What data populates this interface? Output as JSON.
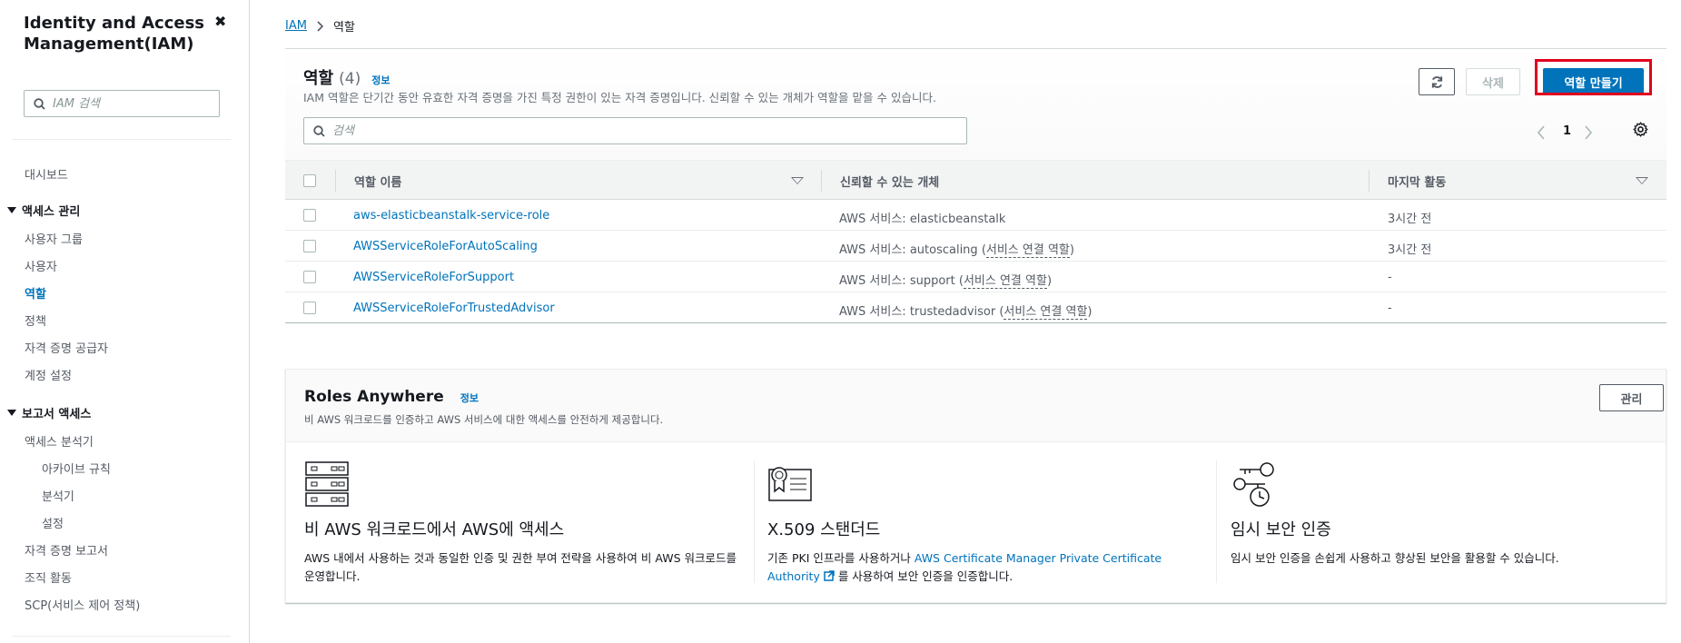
{
  "sidebar": {
    "title": "Identity and Access Management(IAM)",
    "search_placeholder": "IAM 검색",
    "dashboard": "대시보드",
    "access_mgmt": {
      "label": "액세스 관리",
      "items": [
        "사용자 그룹",
        "사용자",
        "역할",
        "정책",
        "자격 증명 공급자",
        "계정 설정"
      ]
    },
    "reports": {
      "label": "보고서 액세스",
      "items": [
        "액세스 분석기",
        "아카이브 규칙",
        "분석기",
        "설정",
        "자격 증명 보고서",
        "조직 활동",
        "SCP(서비스 제어 정책)"
      ]
    }
  },
  "breadcrumb": {
    "root": "IAM",
    "current": "역할"
  },
  "roles": {
    "title": "역할",
    "count": "(4)",
    "info": "정보",
    "description": "IAM 역할은 단기간 동안 유효한 자격 증명을 가진 특정 권한이 있는 자격 증명입니다. 신뢰할 수 있는 개체가 역할을 맡을 수 있습니다.",
    "delete_label": "삭제",
    "create_label": "역할 만들기",
    "search_placeholder": "검색",
    "page": "1",
    "columns": [
      "역할 이름",
      "신뢰할 수 있는 개체",
      "마지막 활동"
    ],
    "rows": [
      {
        "name": "aws-elasticbeanstalk-service-role",
        "trusted_prefix": "AWS 서비스: elasticbeanstalk",
        "trusted_open": "",
        "trusted_link": "",
        "trusted_close": "",
        "activity": "3시간 전"
      },
      {
        "name": "AWSServiceRoleForAutoScaling",
        "trusted_prefix": "AWS 서비스: autoscaling ",
        "trusted_open": "(",
        "trusted_link": "서비스 연결 역할",
        "trusted_close": ")",
        "activity": "3시간 전"
      },
      {
        "name": "AWSServiceRoleForSupport",
        "trusted_prefix": "AWS 서비스: support ",
        "trusted_open": "(",
        "trusted_link": "서비스 연결 역할",
        "trusted_close": ")",
        "activity": "-"
      },
      {
        "name": "AWSServiceRoleForTrustedAdvisor",
        "trusted_prefix": "AWS 서비스: trustedadvisor ",
        "trusted_open": "(",
        "trusted_link": "서비스 연결 역할",
        "trusted_close": ")",
        "activity": "-"
      }
    ]
  },
  "roles_anywhere": {
    "title": "Roles Anywhere",
    "info": "정보",
    "description": "비 AWS 워크로드를 인증하고 AWS 서비스에 대한 액세스를 안전하게 제공합니다.",
    "manage_label": "관리",
    "col1": {
      "title": "비 AWS 워크로드에서 AWS에 액세스",
      "desc": "AWS 내에서 사용하는 것과 동일한 인증 및 권한 부여 전략을 사용하여 비 AWS 워크로드를 운영합니다."
    },
    "col2": {
      "title": "X.509 스탠더드",
      "desc_pre": "기존 PKI 인프라를 사용하거나 ",
      "desc_link": "AWS Certificate Manager Private Certificate Authority",
      "desc_post": " 를 사용하여 보안 인증을 인증합니다."
    },
    "col3": {
      "title": "임시 보안 인증",
      "desc": "임시 보안 인증을 손쉽게 사용하고 향상된 보안을 활용할 수 있습니다."
    }
  },
  "icons": [
    "close-icon",
    "search-icon",
    "caret-down-icon",
    "refresh-icon",
    "chevron-left-icon",
    "chevron-right-icon",
    "gear-icon",
    "sort-icon",
    "server-rack-icon",
    "certificate-icon",
    "keys-clock-icon",
    "external-link-icon"
  ],
  "colors": {
    "accent": "#0073bb",
    "highlight": "#e1001e",
    "text": "#16191f"
  }
}
